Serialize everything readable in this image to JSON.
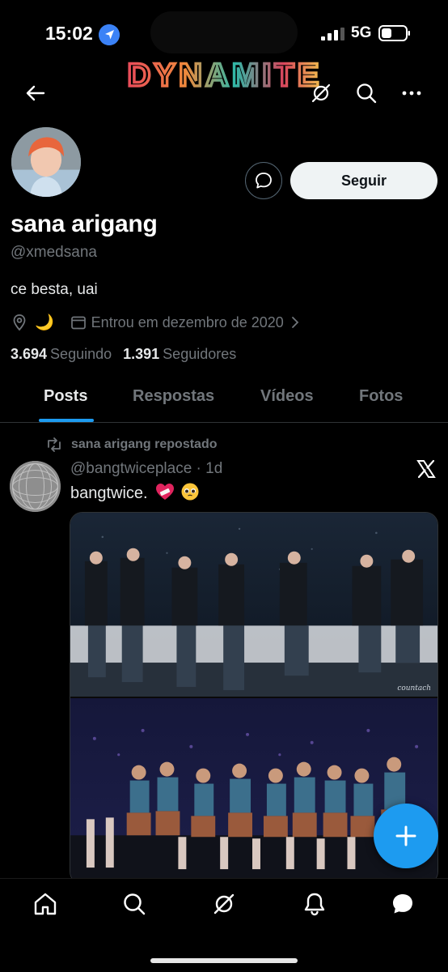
{
  "status_bar": {
    "time": "15:02",
    "network": "5G"
  },
  "header": {
    "banner_text": "DYNAMITE"
  },
  "profile": {
    "display_name": "sana arigang",
    "handle": "@xmedsana",
    "bio": "ce besta, uai",
    "location_emoji": "🌙",
    "joined": "Entrou em dezembro de 2020",
    "following_count": "3.694",
    "following_label": "Seguindo",
    "followers_count": "1.391",
    "followers_label": "Seguidores",
    "follow_label": "Seguir"
  },
  "tabs": [
    {
      "label": "Posts",
      "active": true
    },
    {
      "label": "Respostas",
      "active": false
    },
    {
      "label": "Vídeos",
      "active": false
    },
    {
      "label": "Fotos",
      "active": false
    }
  ],
  "post": {
    "repost_label": "sana arigang repostado",
    "author_handle": "@bangtwiceplace",
    "time": "1d",
    "handle_and_time": "@bangtwiceplace · 1d",
    "text": "bangtwice.",
    "watermark": "countach"
  },
  "colors": {
    "accent": "#1d9bf0",
    "background": "#000000",
    "muted": "#71767b",
    "text": "#e7e9ea"
  },
  "icons": {
    "back": "arrow-left-icon",
    "header_actions": [
      "grok-icon",
      "search-icon",
      "more-icon"
    ],
    "bottom_nav": [
      "home-icon",
      "search-icon",
      "grok-icon",
      "notifications-icon",
      "messages-icon"
    ]
  }
}
